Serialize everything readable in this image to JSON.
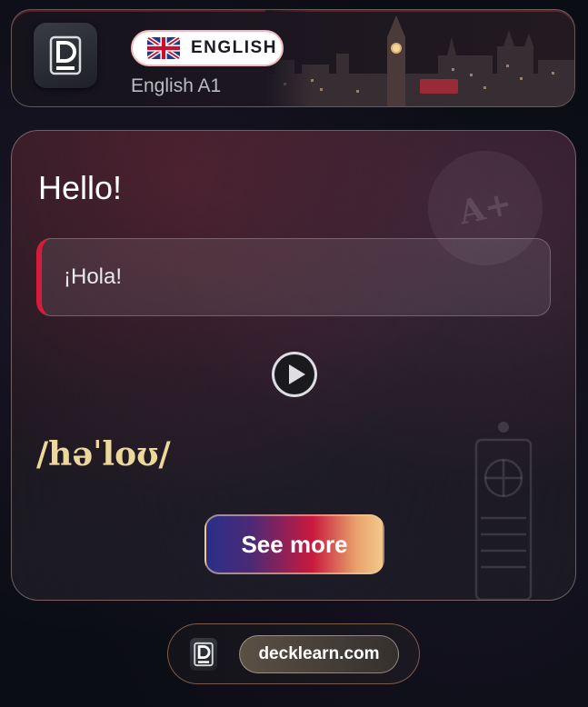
{
  "header": {
    "language_label": "ENGLISH",
    "course_label": "English A1",
    "flag_icon": "uk-flag-icon",
    "logo_icon": "decklearn-logo-icon"
  },
  "card": {
    "word": "Hello!",
    "translation": "¡Hola!",
    "phonetic": "/həˈloʊ/",
    "play_icon": "play-icon",
    "decoration_badge": "A+",
    "see_more_label": "See more"
  },
  "footer": {
    "site_label": "decklearn.com",
    "logo_icon": "decklearn-logo-icon"
  },
  "colors": {
    "accent_red": "#d51d3a",
    "phonetic_gold": "#ecd79c",
    "background": "#0b0d14"
  }
}
